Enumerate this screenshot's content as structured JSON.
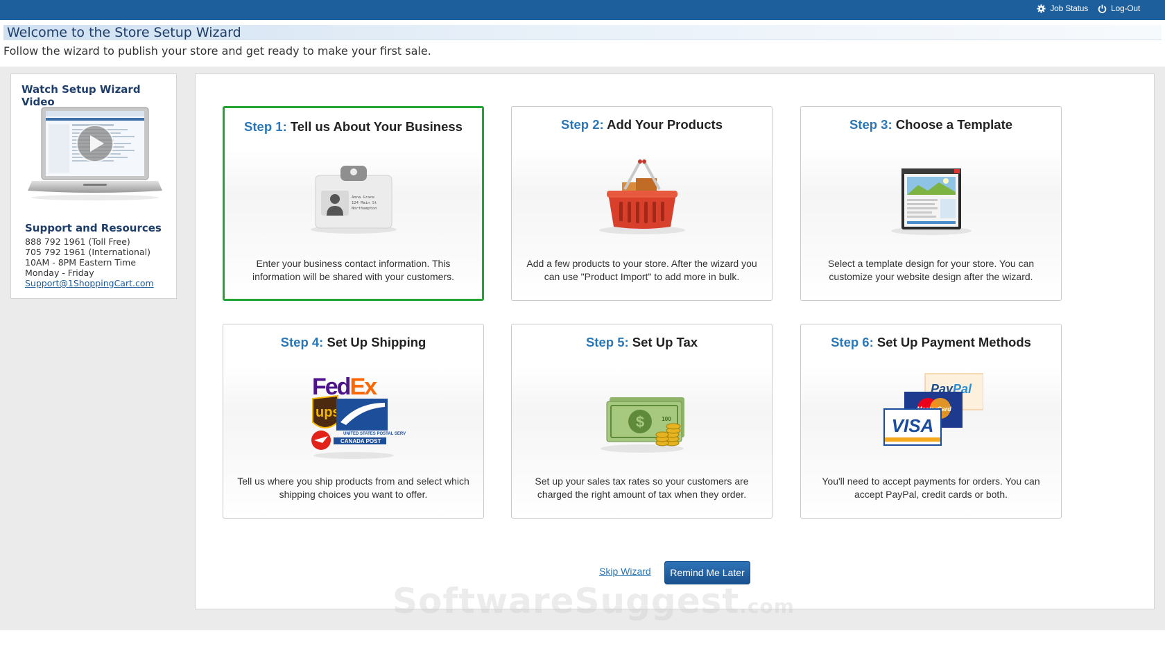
{
  "topbar": {
    "job_status_label": "Job Status",
    "logout_label": "Log-Out"
  },
  "header": {
    "title": "Welcome to the Store Setup Wizard",
    "subtitle": "Follow the wizard to publish your store and get ready to make your first sale."
  },
  "sidebar": {
    "video_title": "Watch Setup Wizard Video",
    "support_title": "Support and Resources",
    "phone_toll_free": "888 792 1961 (Toll Free)",
    "phone_international": "705 792 1961 (International)",
    "hours": "10AM - 8PM Eastern Time",
    "days": "Monday - Friday",
    "email": "Support@1ShoppingCart.com"
  },
  "steps": [
    {
      "number": "Step 1:",
      "title": "Tell us About Your Business",
      "description": "Enter your business contact information. This information will be shared with your customers.",
      "active": true,
      "icon": "business-card-icon",
      "card_text": [
        "Anna Grace",
        "124 Main St",
        "Northampton"
      ]
    },
    {
      "number": "Step 2:",
      "title": "Add Your Products",
      "description": "Add a few products to your store. After the wizard you can use \"Product Import\" to add more in bulk.",
      "active": false,
      "icon": "shopping-basket-icon"
    },
    {
      "number": "Step 3:",
      "title": "Choose a Template",
      "description": "Select a template design for your store. You can customize your website design after the wizard.",
      "active": false,
      "icon": "website-template-icon"
    },
    {
      "number": "Step 4:",
      "title": "Set Up Shipping",
      "description": "Tell us where you ship products from and select which shipping choices you want to offer.",
      "active": false,
      "icon": "shipping-carriers-icon",
      "logos": [
        "FedEx",
        "ups",
        "UNITED STATES POSTAL SERVICE",
        "CANADA POST"
      ]
    },
    {
      "number": "Step 5:",
      "title": "Set Up Tax",
      "description": "Set up your sales tax rates so your customers are charged the right amount of tax when they order.",
      "active": false,
      "icon": "money-stack-icon",
      "bill_label": "100"
    },
    {
      "number": "Step 6:",
      "title": "Set Up Payment Methods",
      "description": "You'll need to accept payments for orders. You can accept PayPal, credit cards or both.",
      "active": false,
      "icon": "payment-cards-icon",
      "logos": [
        "PayPal",
        "MasterCard",
        "VISA"
      ]
    }
  ],
  "actions": {
    "skip_label": "Skip Wizard",
    "remind_label": "Remind Me Later"
  },
  "watermark": {
    "main": "SoftwareSuggest",
    "suffix": ".com"
  },
  "colors": {
    "topbar": "#1d5e9c",
    "step_number": "#2a77b7",
    "active_border": "#23a332",
    "heading": "#1d3d6a"
  }
}
